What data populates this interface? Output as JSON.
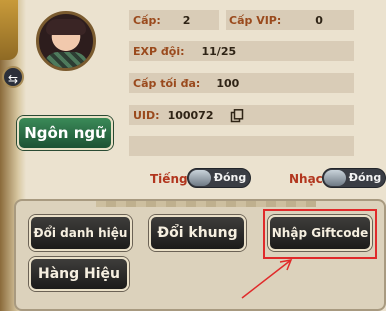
{
  "profile": {
    "level_label": "Cấp:",
    "level_value": "2",
    "vip_label": "Cấp VIP:",
    "vip_value": "0",
    "exp_label": "EXP đội:",
    "exp_value": "11/25",
    "max_level_label": "Cấp tối đa:",
    "max_level_value": "100",
    "uid_label": "UID:",
    "uid_value": "100072"
  },
  "language_button": "Ngôn ngữ",
  "sound": {
    "voice_label": "Tiếng",
    "voice_state": "Đóng",
    "music_label": "Nhạc",
    "music_state": "Đóng"
  },
  "actions": {
    "change_title": "Đổi danh hiệu",
    "change_frame": "Đổi khung",
    "giftcode": "Nhập Giftcode",
    "brand": "Hàng Hiệu"
  },
  "icons": {
    "copy": "copy-icon",
    "side": "arrows-icon"
  },
  "colors": {
    "label": "#9a4a1d",
    "highlight": "#e02a2a",
    "green_button": "#2a6b43"
  }
}
